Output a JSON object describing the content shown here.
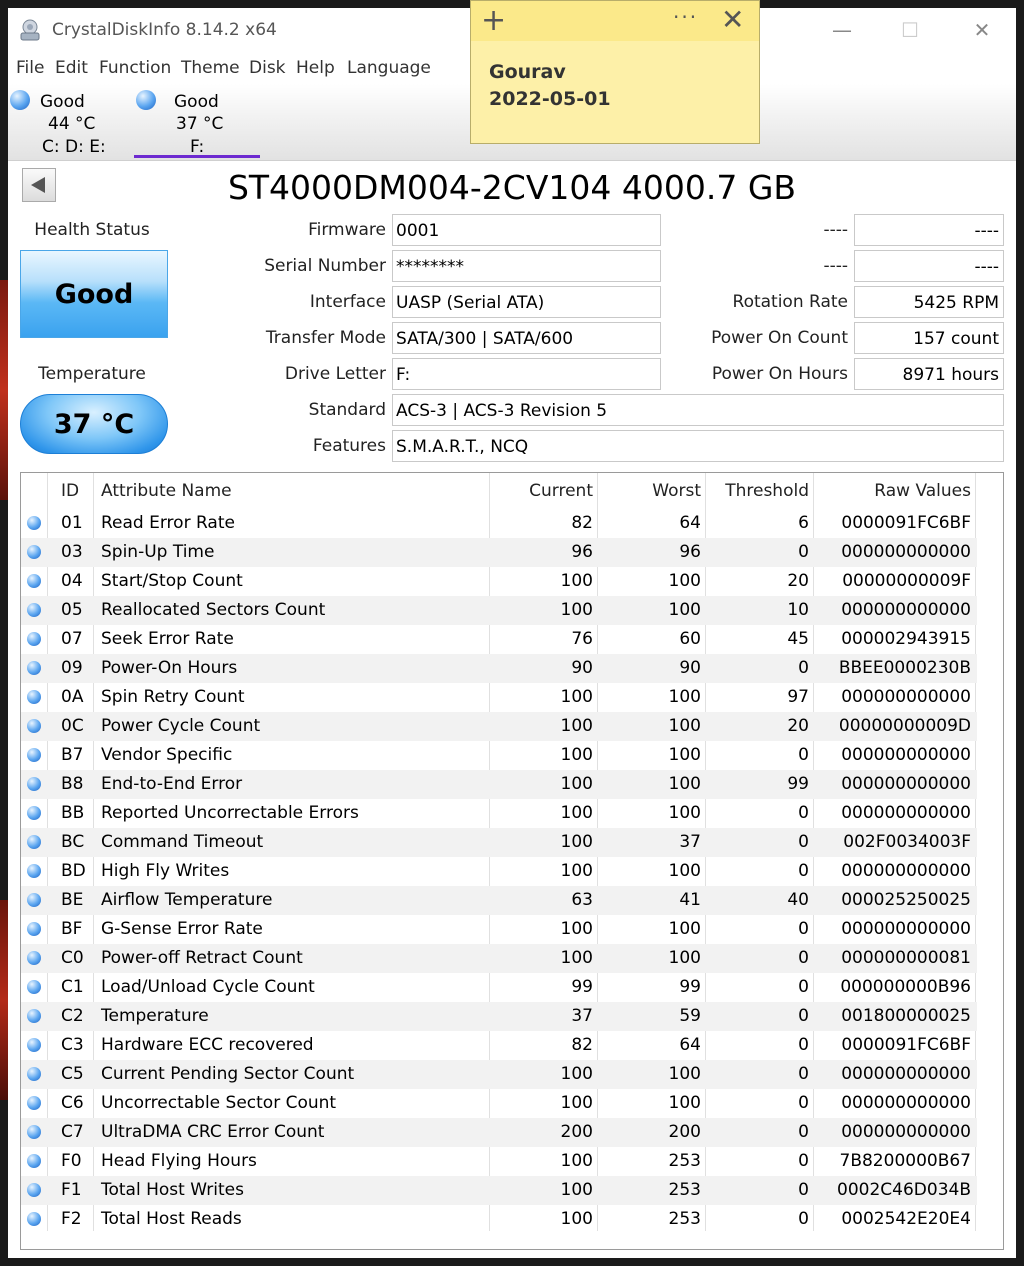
{
  "app": {
    "title": "CrystalDiskInfo 8.14.2 x64"
  },
  "menu": [
    "File",
    "Edit",
    "Function",
    "Theme",
    "Disk",
    "Help",
    "Language"
  ],
  "disks": [
    {
      "status": "Good",
      "temp": "44 °C",
      "letters": "C: D: E:"
    },
    {
      "status": "Good",
      "temp": "37 °C",
      "letters": "F:"
    }
  ],
  "model": "ST4000DM004-2CV104 4000.7 GB",
  "health": {
    "label": "Health Status",
    "value": "Good"
  },
  "temperature": {
    "label": "Temperature",
    "value": "37 °C"
  },
  "info": {
    "firmware_label": "Firmware",
    "firmware": "0001",
    "serial_label": "Serial Number",
    "serial": "********",
    "interface_label": "Interface",
    "interface": "UASP (Serial ATA)",
    "transfer_label": "Transfer Mode",
    "transfer": "SATA/300 | SATA/600",
    "drive_letter_label": "Drive Letter",
    "drive_letter": "F:",
    "standard_label": "Standard",
    "standard": "ACS-3 | ACS-3 Revision 5",
    "features_label": "Features",
    "features": "S.M.A.R.T., NCQ",
    "blank1_label": "----",
    "blank1": "----",
    "blank2_label": "----",
    "blank2": "----",
    "rotation_label": "Rotation Rate",
    "rotation": "5425 RPM",
    "power_count_label": "Power On Count",
    "power_count": "157 count",
    "power_hours_label": "Power On Hours",
    "power_hours": "8971 hours"
  },
  "smart": {
    "headers": [
      "ID",
      "Attribute Name",
      "Current",
      "Worst",
      "Threshold",
      "Raw Values"
    ],
    "rows": [
      [
        "01",
        "Read Error Rate",
        "82",
        "64",
        "6",
        "0000091FC6BF"
      ],
      [
        "03",
        "Spin-Up Time",
        "96",
        "96",
        "0",
        "000000000000"
      ],
      [
        "04",
        "Start/Stop Count",
        "100",
        "100",
        "20",
        "00000000009F"
      ],
      [
        "05",
        "Reallocated Sectors Count",
        "100",
        "100",
        "10",
        "000000000000"
      ],
      [
        "07",
        "Seek Error Rate",
        "76",
        "60",
        "45",
        "000002943915"
      ],
      [
        "09",
        "Power-On Hours",
        "90",
        "90",
        "0",
        "BBEE0000230B"
      ],
      [
        "0A",
        "Spin Retry Count",
        "100",
        "100",
        "97",
        "000000000000"
      ],
      [
        "0C",
        "Power Cycle Count",
        "100",
        "100",
        "20",
        "00000000009D"
      ],
      [
        "B7",
        "Vendor Specific",
        "100",
        "100",
        "0",
        "000000000000"
      ],
      [
        "B8",
        "End-to-End Error",
        "100",
        "100",
        "99",
        "000000000000"
      ],
      [
        "BB",
        "Reported Uncorrectable Errors",
        "100",
        "100",
        "0",
        "000000000000"
      ],
      [
        "BC",
        "Command Timeout",
        "100",
        "37",
        "0",
        "002F0034003F"
      ],
      [
        "BD",
        "High Fly Writes",
        "100",
        "100",
        "0",
        "000000000000"
      ],
      [
        "BE",
        "Airflow Temperature",
        "63",
        "41",
        "40",
        "000025250025"
      ],
      [
        "BF",
        "G-Sense Error Rate",
        "100",
        "100",
        "0",
        "000000000000"
      ],
      [
        "C0",
        "Power-off Retract Count",
        "100",
        "100",
        "0",
        "000000000081"
      ],
      [
        "C1",
        "Load/Unload Cycle Count",
        "99",
        "99",
        "0",
        "000000000B96"
      ],
      [
        "C2",
        "Temperature",
        "37",
        "59",
        "0",
        "001800000025"
      ],
      [
        "C3",
        "Hardware ECC recovered",
        "82",
        "64",
        "0",
        "0000091FC6BF"
      ],
      [
        "C5",
        "Current Pending Sector Count",
        "100",
        "100",
        "0",
        "000000000000"
      ],
      [
        "C6",
        "Uncorrectable Sector Count",
        "100",
        "100",
        "0",
        "000000000000"
      ],
      [
        "C7",
        "UltraDMA CRC Error Count",
        "200",
        "200",
        "0",
        "000000000000"
      ],
      [
        "F0",
        "Head Flying Hours",
        "100",
        "253",
        "0",
        "7B8200000B67"
      ],
      [
        "F1",
        "Total Host Writes",
        "100",
        "253",
        "0",
        "0002C46D034B"
      ],
      [
        "F2",
        "Total Host Reads",
        "100",
        "253",
        "0",
        "0002542E20E4"
      ]
    ]
  },
  "sticky": {
    "name": "Gourav",
    "date": "2022-05-01",
    "plus": "+",
    "more": "···",
    "close": "✕"
  },
  "window_controls": {
    "minimize": "—",
    "maximize": "☐",
    "close": "✕"
  }
}
